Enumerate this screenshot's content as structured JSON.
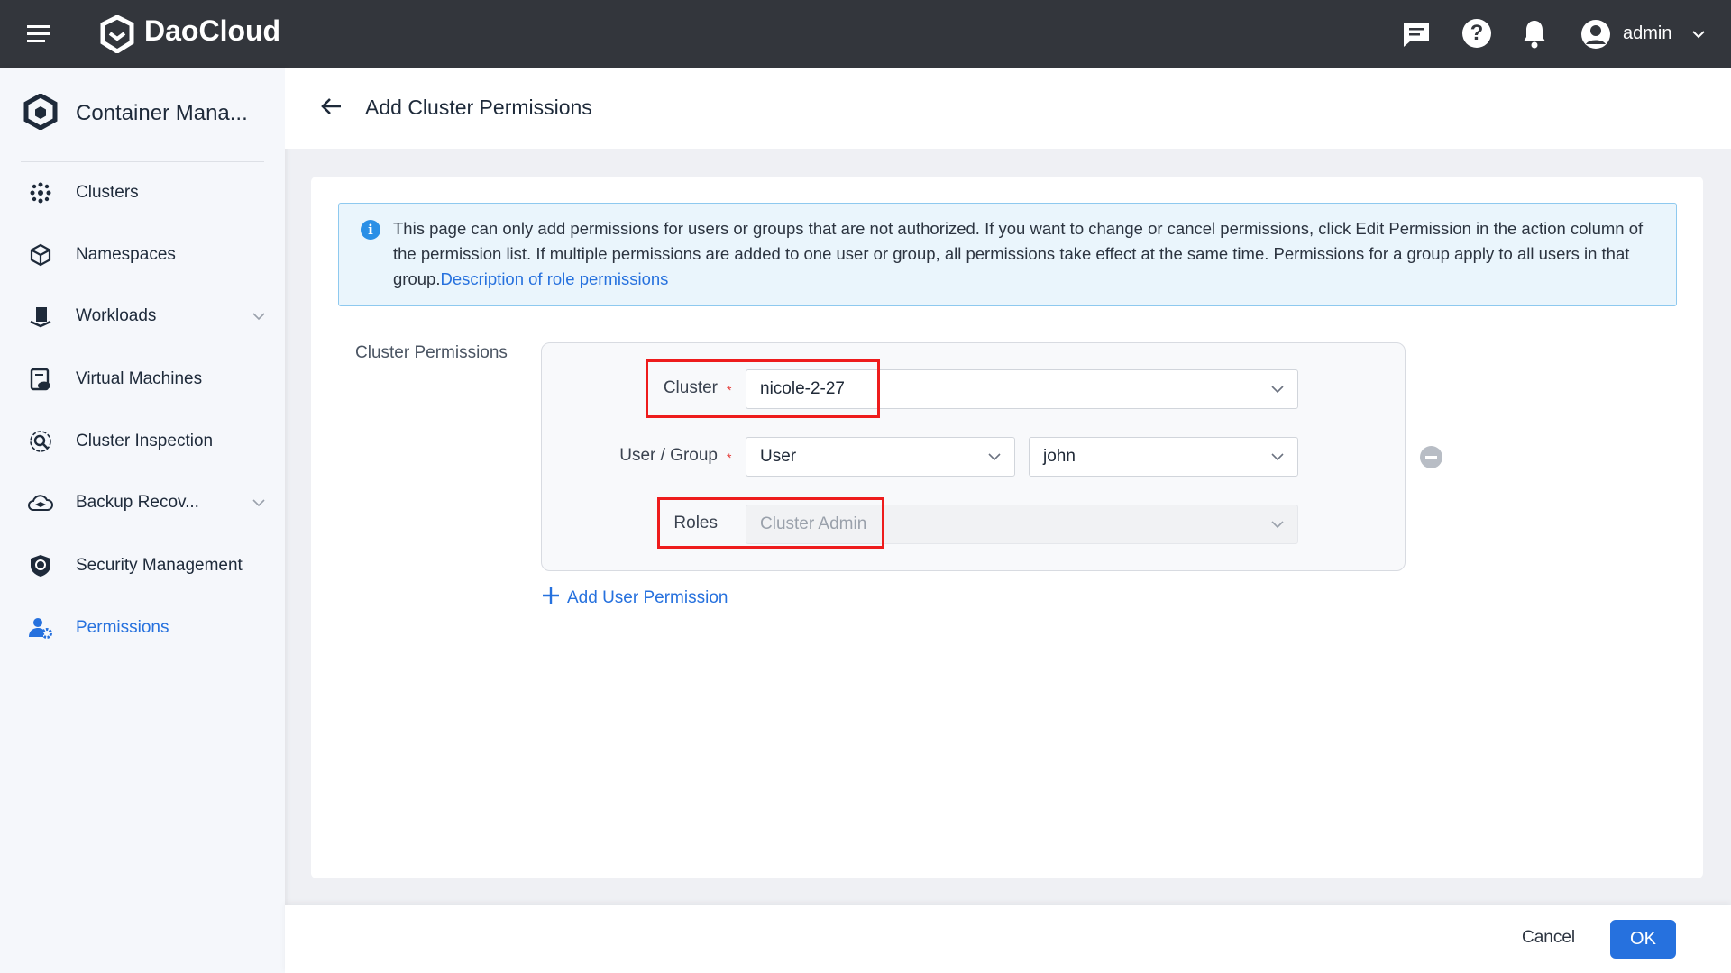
{
  "topbar": {
    "brand": "DaoCloud",
    "user": "admin"
  },
  "sidebar": {
    "title": "Container Mana...",
    "items": [
      {
        "label": "Clusters"
      },
      {
        "label": "Namespaces"
      },
      {
        "label": "Workloads"
      },
      {
        "label": "Virtual Machines"
      },
      {
        "label": "Cluster Inspection"
      },
      {
        "label": "Backup Recov..."
      },
      {
        "label": "Security Management"
      },
      {
        "label": "Permissions"
      }
    ]
  },
  "header": {
    "title": "Add Cluster Permissions"
  },
  "info": {
    "text": "This page can only add permissions for users or groups that are not authorized. If you want to change or cancel permissions, click Edit Permission in the action column of the permission list. If multiple permissions are added to one user or group, all permissions take effect at the same time. Permissions for a group apply to all users in that group.",
    "link": "Description of role permissions"
  },
  "form": {
    "section_label": "Cluster Permissions",
    "cluster_label": "Cluster",
    "cluster_value": "nicole-2-27",
    "usergroup_label": "User / Group",
    "type_value": "User",
    "user_value": "john",
    "roles_label": "Roles",
    "roles_placeholder": "Cluster Admin",
    "add_label": "Add User Permission",
    "required_mark": "*"
  },
  "footer": {
    "cancel": "Cancel",
    "ok": "OK"
  },
  "colors": {
    "accent": "#2671de",
    "topbar": "#33363c",
    "highlight": "#ee1c1c"
  }
}
